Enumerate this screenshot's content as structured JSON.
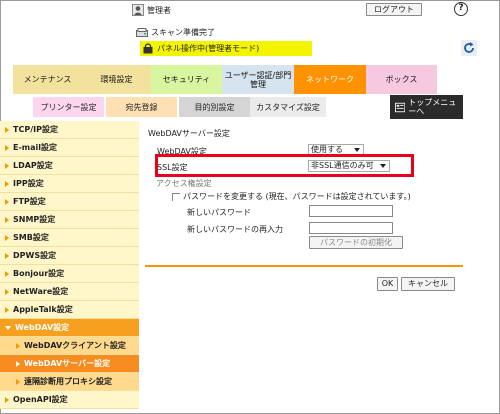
{
  "header": {
    "user_name": "管理者",
    "logout_label": "ログアウト",
    "help_label": "?",
    "scan_status": "スキャン準備完了",
    "mode_text": "パネル操作中(管理者モード)"
  },
  "tabs": [
    {
      "label": "メンテナンス"
    },
    {
      "label": "環境設定"
    },
    {
      "label": "セキュリティ"
    },
    {
      "label": "ユーザー認証/部門管理"
    },
    {
      "label": "ネットワーク"
    },
    {
      "label": "ボックス"
    }
  ],
  "subtabs": [
    {
      "label": "プリンター設定"
    },
    {
      "label": "宛先登録"
    },
    {
      "label": "目的別設定"
    },
    {
      "label": "カスタマイズ設定"
    }
  ],
  "top_menu_label": "トップメニューへ",
  "sidebar": {
    "items": [
      {
        "label": "TCP/IP設定"
      },
      {
        "label": "E-mail設定"
      },
      {
        "label": "LDAP設定"
      },
      {
        "label": "IPP設定"
      },
      {
        "label": "FTP設定"
      },
      {
        "label": "SNMP設定"
      },
      {
        "label": "SMB設定"
      },
      {
        "label": "DPWS設定"
      },
      {
        "label": "Bonjour設定"
      },
      {
        "label": "NetWare設定"
      },
      {
        "label": "AppleTalk設定"
      },
      {
        "label": "WebDAV設定"
      },
      {
        "label": "WebDAVクライアント設定"
      },
      {
        "label": "WebDAVサーバー設定"
      },
      {
        "label": "遠隔診断用プロキシ設定"
      },
      {
        "label": "OpenAPI設定"
      }
    ]
  },
  "main": {
    "title": "WebDAVサーバー設定",
    "webdav_label": "WebDAV設定",
    "webdav_value": "使用する",
    "ssl_label": "SSL設定",
    "ssl_value": "非SSL通信のみ可",
    "access_label": "アクセス権設定",
    "change_password_label": "パスワードを変更する (現在、パスワードは設定されています。)",
    "new_password_label": "新しいパスワード",
    "confirm_password_label": "新しいパスワードの再入力",
    "init_password_label": "パスワードの初期化",
    "ok_label": "OK",
    "cancel_label": "キャンセル"
  },
  "colors": {
    "accent": "#f39800",
    "highlight_box": "#e8001c",
    "mode_bar": "#f4f400",
    "network_tab": "#ff9200"
  },
  "icons": [
    "user-icon",
    "help-icon",
    "scanner-icon",
    "panel-lock-icon",
    "refresh-icon",
    "top-menu-icon",
    "arrow-right-icon"
  ]
}
